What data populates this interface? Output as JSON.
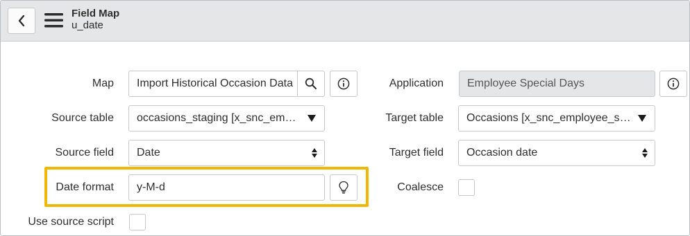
{
  "header": {
    "title": "Field Map",
    "subtitle": "u_date"
  },
  "form": {
    "map": {
      "label": "Map",
      "value": "Import Historical Occasion Data"
    },
    "application": {
      "label": "Application",
      "value": "Employee Special Days"
    },
    "source_table": {
      "label": "Source table",
      "value": "occasions_staging [x_snc_emplo…"
    },
    "target_table": {
      "label": "Target table",
      "value": "Occasions [x_snc_employee_spe…"
    },
    "source_field": {
      "label": "Source field",
      "value": "Date"
    },
    "target_field": {
      "label": "Target field",
      "value": "Occasion date"
    },
    "date_format": {
      "label": "Date format",
      "value": "y-M-d"
    },
    "coalesce": {
      "label": "Coalesce",
      "checked": false
    },
    "use_source_script": {
      "label": "Use source script",
      "checked": false
    }
  },
  "icons": {
    "back": "chevron-left-icon",
    "menu": "hamburger-menu-icon",
    "search": "search-icon",
    "info": "info-icon",
    "hint": "lightbulb-icon"
  },
  "colors": {
    "header_bg": "#e4e6e7",
    "highlight": "#f2b705",
    "readonly_bg": "#e4e6e7"
  }
}
